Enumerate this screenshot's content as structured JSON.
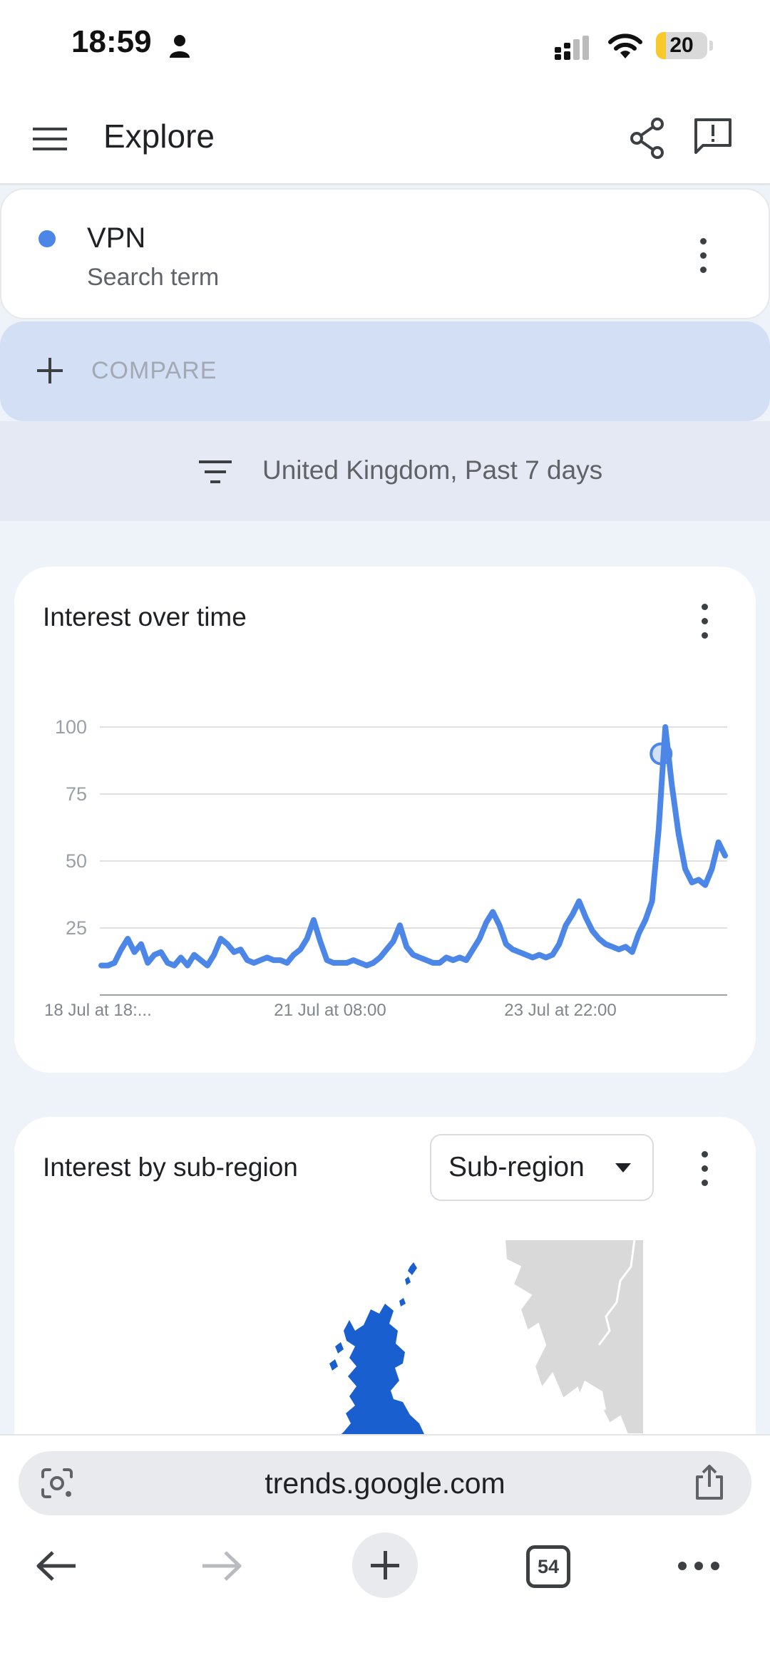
{
  "status_bar": {
    "time": "18:59",
    "battery_level": "20",
    "battery_fraction": 0.2,
    "battery_color": "#f7c92b"
  },
  "app_bar": {
    "menu_icon": "hamburger-menu-icon",
    "title": "Explore",
    "share_icon": "share-icon",
    "feedback_icon": "feedback-icon"
  },
  "search_term": {
    "name": "VPN",
    "type": "Search term",
    "color": "#4c87e8"
  },
  "compare": {
    "label": "COMPARE"
  },
  "filter": {
    "label": "United Kingdom, Past 7 days"
  },
  "interest_over_time": {
    "title": "Interest over time"
  },
  "chart_data": {
    "type": "line",
    "title": "Interest over time",
    "xlabel": "",
    "ylabel": "",
    "ylim": [
      0,
      100
    ],
    "yticks": [
      25,
      50,
      75,
      100
    ],
    "grid": true,
    "x_tick_labels": [
      "18 Jul at 18:...",
      "21 Jul at 08:00",
      "23 Jul at 22:00"
    ],
    "highlighted_value": 90,
    "series": [
      {
        "color": "#4c87e8",
        "values": [
          11,
          11,
          12,
          17,
          21,
          16,
          19,
          12,
          15,
          16,
          12,
          11,
          14,
          11,
          15,
          13,
          11,
          15,
          21,
          19,
          16,
          17,
          13,
          12,
          13,
          14,
          13,
          13,
          12,
          15,
          17,
          21,
          28,
          20,
          13,
          12,
          12,
          12,
          13,
          12,
          11,
          12,
          14,
          17,
          20,
          26,
          18,
          15,
          14,
          13,
          12,
          12,
          14,
          13,
          14,
          13,
          17,
          21,
          27,
          31,
          26,
          19,
          17,
          16,
          15,
          14,
          15,
          14,
          15,
          19,
          26,
          30,
          35,
          29,
          24,
          21,
          19,
          18,
          17,
          18,
          16,
          23,
          28,
          35,
          62,
          100,
          78,
          60,
          47,
          42,
          43,
          41,
          47,
          57,
          52
        ]
      }
    ]
  },
  "sub_region": {
    "title": "Interest by sub-region",
    "select_value": "Sub-region",
    "map_color": "#1a5fd0",
    "map_other_color": "#d9d9d9"
  },
  "browser": {
    "url": "trends.google.com",
    "tab_count": "54",
    "lens_icon": "lens-icon",
    "share_icon": "upload-share-icon",
    "back_icon": "back-arrow-icon",
    "forward_icon": "forward-arrow-icon",
    "new_tab_icon": "plus-icon",
    "more_icon": "more-horizontal-icon"
  }
}
